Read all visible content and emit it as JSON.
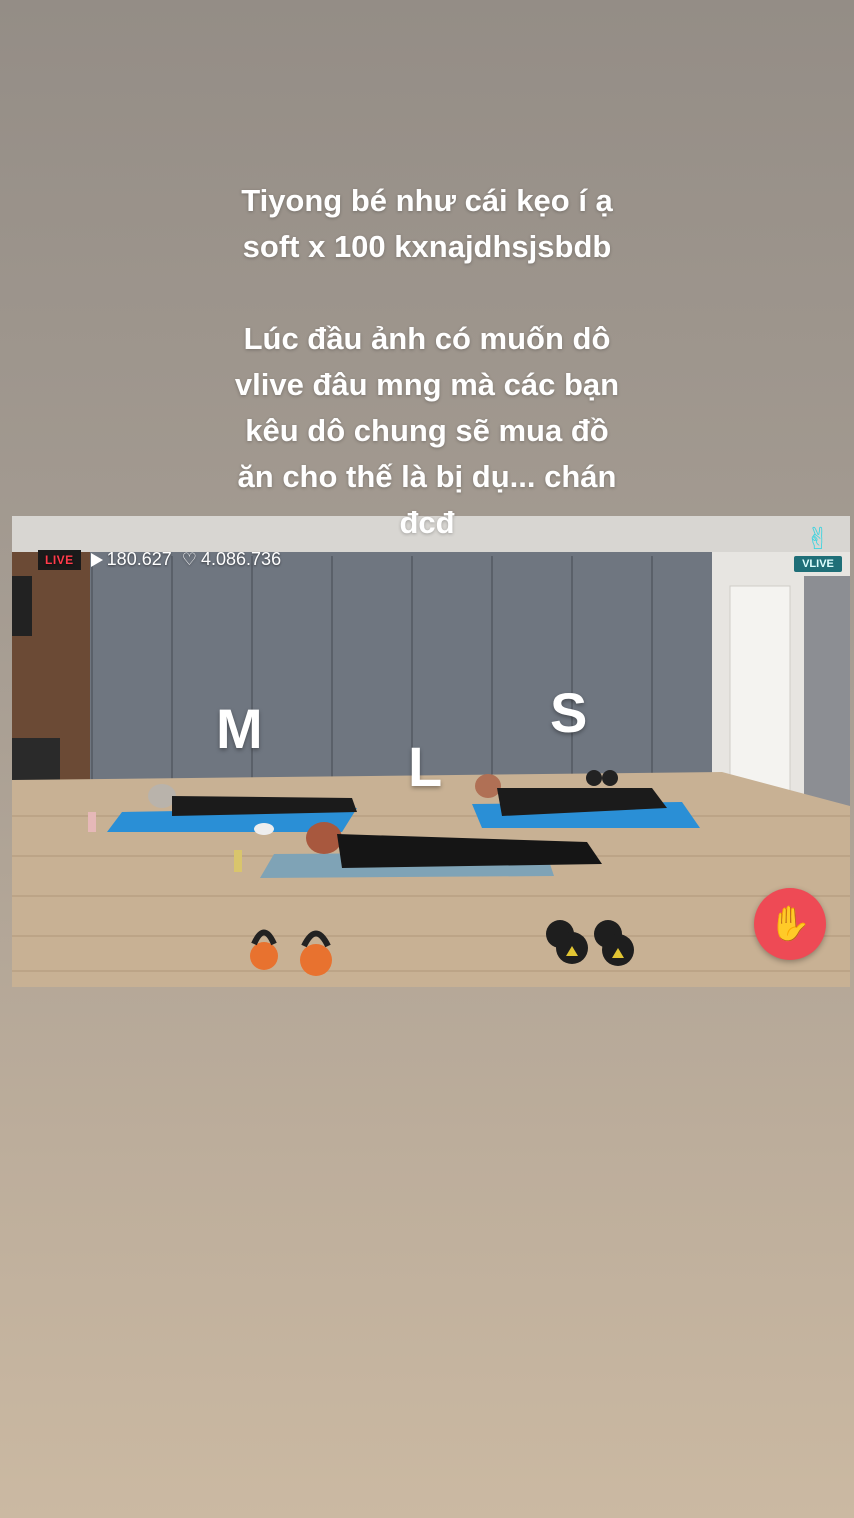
{
  "caption": {
    "line1": "Tiyong bé như cái kẹo í ạ",
    "line2": "soft x 100 kxnajdhsjsbdb",
    "line3": "Lúc đầu ảnh có muốn dô",
    "line4": "vlive đâu mng mà các bạn",
    "line5": "kêu dô chung sẽ mua đồ",
    "line6": "ăn cho thế là bị dụ... chán",
    "line7": "đcđ"
  },
  "video": {
    "live_label": "LIVE",
    "play_count": "180.627",
    "like_count": "4.086.736",
    "logo_text": "VLIVE",
    "labels": {
      "m": "M",
      "l": "L",
      "s": "S"
    }
  },
  "icons": {
    "play": "play-icon",
    "heart": "heart-icon",
    "vlive": "vlive-logo-icon",
    "finger_heart": "finger-heart-icon"
  },
  "colors": {
    "live_red": "#ff3b4a",
    "vlive_cyan": "#3ed3df",
    "heart_button": "#ee4a55",
    "mat_blue": "#2a8fd6"
  }
}
